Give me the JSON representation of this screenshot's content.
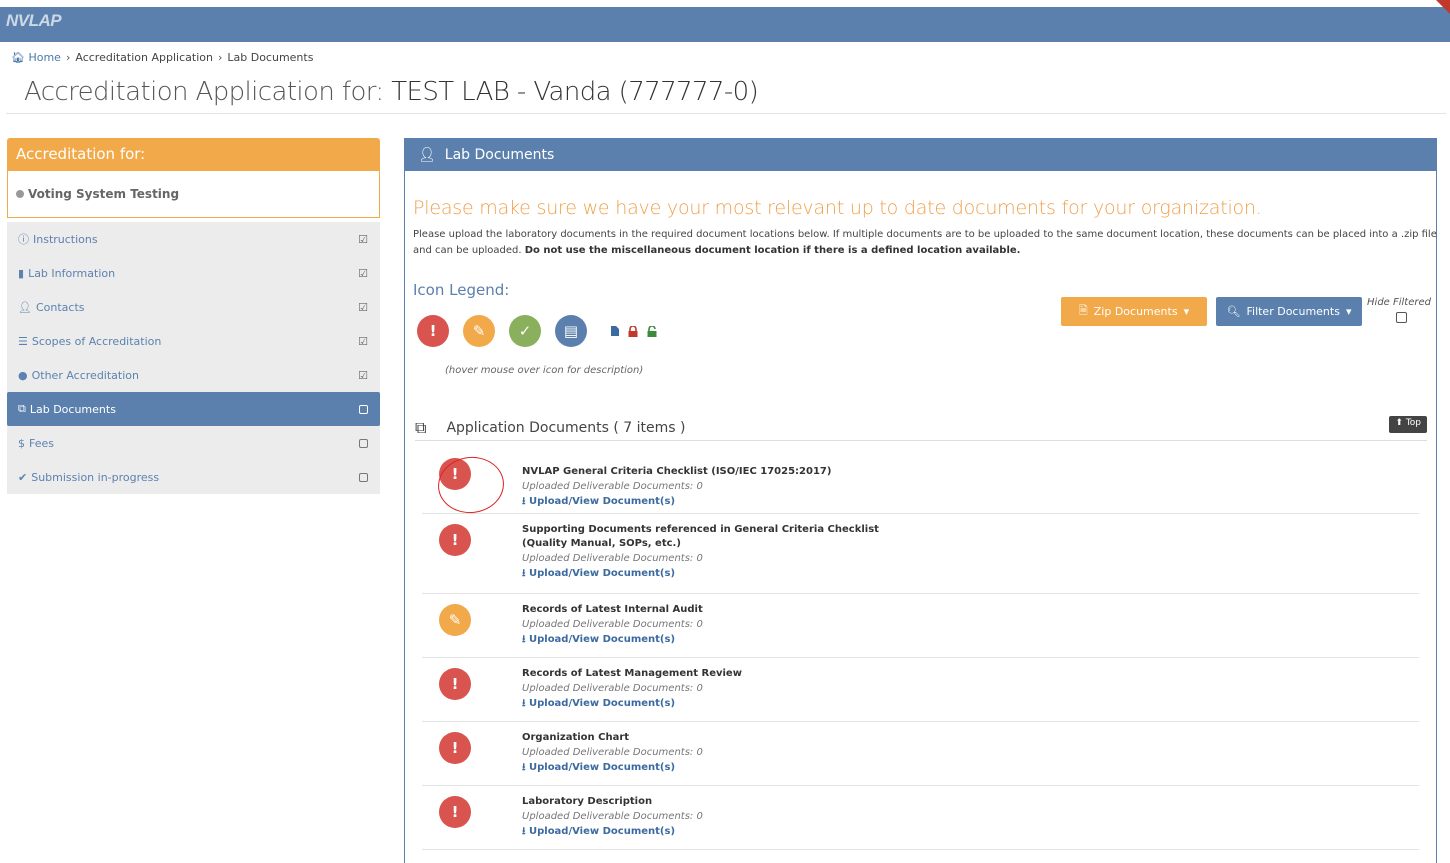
{
  "app": {
    "logo": "NVLAP"
  },
  "breadcrumb": {
    "home": "Home",
    "items": [
      "Accreditation Application",
      "Lab Documents"
    ]
  },
  "page_title": {
    "prefix": "Accreditation Application for:",
    "lab": "TEST LAB - Vanda (777777-0)"
  },
  "sidebar": {
    "header": "Accreditation for:",
    "program": "Voting System Testing",
    "items": [
      {
        "label": "Instructions",
        "icon": "info-circle-icon",
        "status": "checked"
      },
      {
        "label": "Lab Information",
        "icon": "building-icon",
        "status": "checked"
      },
      {
        "label": "Contacts",
        "icon": "user-icon",
        "status": "checked"
      },
      {
        "label": "Scopes of Accreditation",
        "icon": "list-icon",
        "status": "checked"
      },
      {
        "label": "Other Accreditation",
        "icon": "circle-icon",
        "status": "checked"
      },
      {
        "label": "Lab Documents",
        "icon": "copy-icon",
        "status": "unchecked",
        "active": true
      },
      {
        "label": "Fees",
        "icon": "dollar-icon",
        "status": "unchecked"
      },
      {
        "label": "Submission in-progress",
        "icon": "check-icon",
        "status": "unchecked"
      }
    ]
  },
  "panel": {
    "title": "Lab Documents",
    "notice": "Please make sure we have your most relevant up to date documents for your organization.",
    "desc_1": "Please upload the laboratory documents in the required document locations below. If multiple documents are to be uploaded to the same document location, these documents can be placed into a .zip file and can be uploaded.",
    "desc_2": "Do not use the miscellaneous document location if there is a defined location available.",
    "legend_title": "Icon Legend:",
    "legend_hint": "(hover mouse over icon for description)",
    "zip_label": "Zip Documents",
    "filter_label": "Filter Documents",
    "hide_filtered_label": "Hide Filtered",
    "section_title": "Application Documents ( 7 items )",
    "top_label": "Top",
    "colors": {
      "accent": "#5b80ad",
      "warning": "#f2a94a",
      "danger": "#d9534f",
      "success": "#8aaf5d"
    }
  },
  "documents": [
    {
      "name": "NVLAP General Criteria Checklist (ISO/IEC 17025:2017)",
      "count_label": "Uploaded Deliverable Documents: 0",
      "link": "Upload/View Document(s)",
      "status": "missing"
    },
    {
      "name": "Supporting Documents referenced in General Criteria Checklist",
      "name_2": "(Quality Manual, SOPs, etc.)",
      "count_label": "Uploaded Deliverable Documents: 0",
      "link": "Upload/View Document(s)",
      "status": "missing"
    },
    {
      "name": "Records of Latest Internal Audit",
      "count_label": "Uploaded Deliverable Documents: 0",
      "link": "Upload/View Document(s)",
      "status": "optional"
    },
    {
      "name": "Records of Latest Management Review",
      "count_label": "Uploaded Deliverable Documents: 0",
      "link": "Upload/View Document(s)",
      "status": "missing"
    },
    {
      "name": "Organization Chart",
      "count_label": "Uploaded Deliverable Documents: 0",
      "link": "Upload/View Document(s)",
      "status": "missing"
    },
    {
      "name": "Laboratory Description",
      "count_label": "Uploaded Deliverable Documents: 0",
      "link": "Upload/View Document(s)",
      "status": "missing"
    }
  ]
}
